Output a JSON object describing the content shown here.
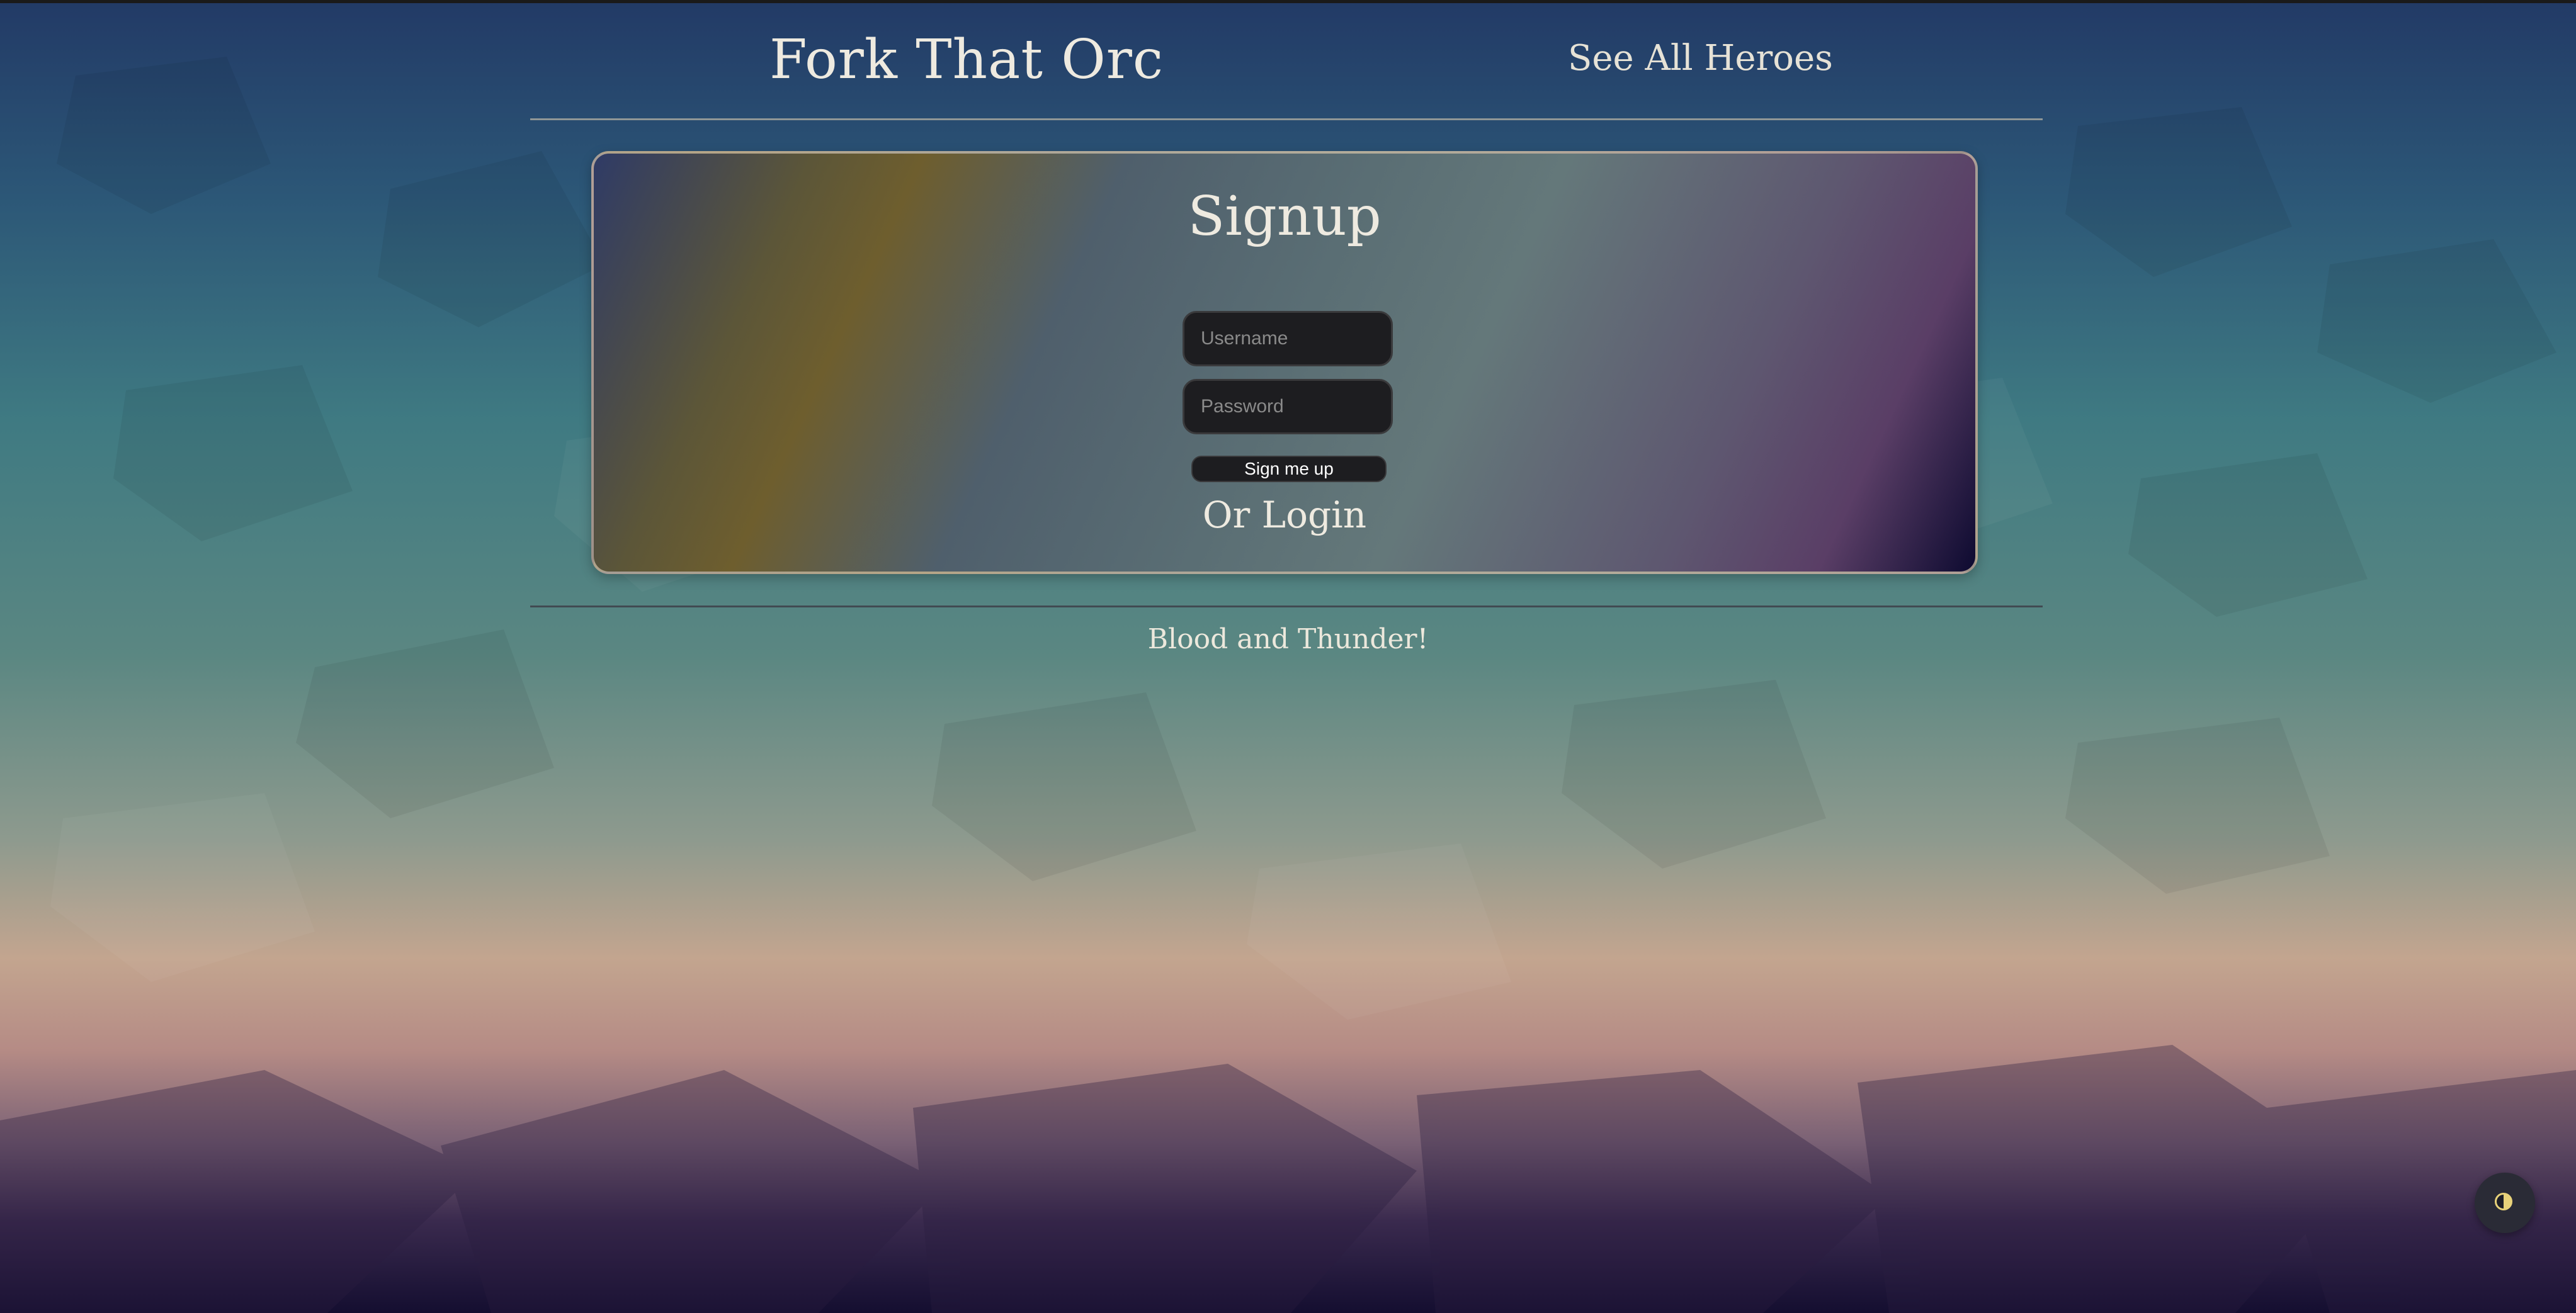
{
  "header": {
    "site_title": "Fork That Orc",
    "nav_link": "See All Heroes"
  },
  "signup": {
    "title": "Signup",
    "username_placeholder": "Username",
    "password_placeholder": "Password",
    "submit_label": "Sign me up",
    "alt_link": "Or Login"
  },
  "footer": {
    "tagline": "Blood and Thunder!"
  },
  "theme_toggle": {
    "icon": "half-circle-contrast-icon"
  }
}
